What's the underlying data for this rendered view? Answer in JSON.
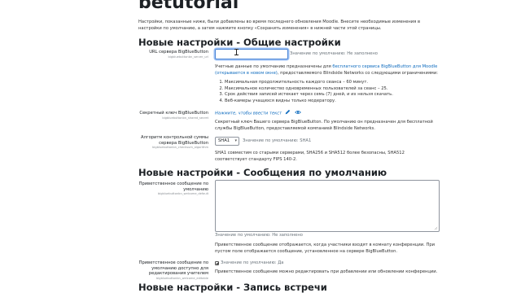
{
  "page": {
    "title": "betutorial",
    "intro": "Настройки, показанные ниже, были добавлены во время последнего обновления Moodle. Внесите необходимые изменения в настройки по умолчанию, а затем нажмите кнопку «Сохранить изменения» в нижней части этой страницы."
  },
  "sections": {
    "general": "Новые настройки - Общие настройки",
    "messages": "Новые настройки - Сообщения по умолчанию",
    "recording": "Новые настройки - Запись встречи"
  },
  "server_url": {
    "label": "URL сервера BigBlueButton",
    "key": "bigbluebuttonbn_server_url",
    "value": "",
    "default": "Значение по умолчанию: Не заполнено",
    "desc_prefix": "Учетные данные по умолчанию предназначены для",
    "desc_link": "бесплатного сервиса BigBlueButton для Moodle (открывается в новом окне)",
    "desc_suffix": ", предоставляемого Blindside Networks со следующими ограничениями:",
    "limits": [
      "Максимальная продолжительность каждого сеанса – 60 минут.",
      "Максимальное количество одновременных пользователей за сеанс – 25.",
      "Срок действия записей истекает через семь (7) дней, и их нельзя скачать.",
      "Веб-камеры учащихся видны только модератору."
    ]
  },
  "shared_secret": {
    "label": "Секретный ключ BigBlueButton",
    "key": "bigbluebuttonbn_shared_secret",
    "placeholder": "Нажмите, чтобы ввести текст",
    "desc": "Секретный ключ Вашего сервера BigBlueButton. По умолчанию он предназначен для бесплатной службы BigBlueButton, предоставляемой компанией Blindside Networks."
  },
  "checksum": {
    "label": "Алгоритм контрольной суммы сервера BigBlueButton",
    "key": "bigbluebuttonbn_checksum_algorithm",
    "selected": "SHA1",
    "default": "Значение по умолчанию: SHA1",
    "desc": "SHA1 совместим со старыми серверами, SHA256 и SHA512 более безопасны, SHA512 соответствует стандарту FIPS 140-2."
  },
  "welcome": {
    "label": "Приветственное сообщение по умолчанию",
    "key": "bigbluebuttonbn_welcome_default",
    "value": "",
    "default": "Значение по умолчанию: Не заполнено",
    "desc": "Приветственное сообщение отображается, когда участники входят в комнату конференции. При пустом поле отображается сообщение, установленное на сервере BigBlueButton."
  },
  "welcome_editable": {
    "label": "Приветственное сообщение по умолчанию доступно для редактирования учителем",
    "key": "bigbluebuttonbn_welcome_editable",
    "checked": true,
    "default": "Значение по умолчанию: Да",
    "desc": "Приветственное сообщение можно редактировать при добавлении или обновлении конференции."
  },
  "icons": {
    "pencil": "pencil-icon",
    "eye": "eye-icon"
  },
  "colors": {
    "link": "#0f6cbf",
    "focus_ring": "#9ec2f5",
    "text": "#1d2125",
    "muted": "#6a737b"
  }
}
